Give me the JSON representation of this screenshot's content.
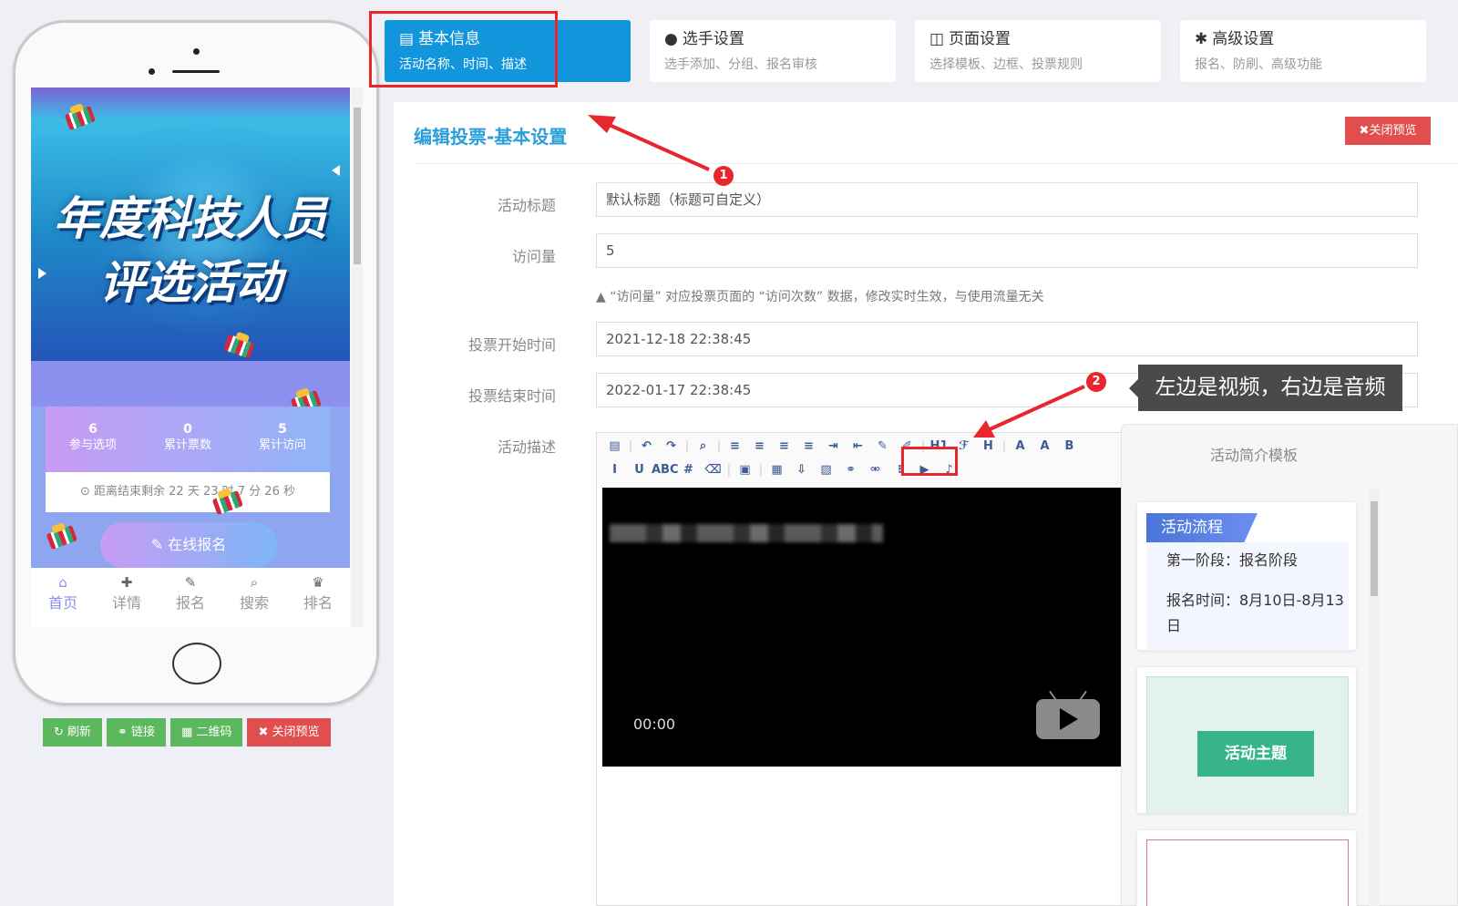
{
  "phone": {
    "banner_line1": "年度科技人员",
    "banner_line2": "评选活动",
    "stats": [
      {
        "num": "6",
        "label": "参与选项"
      },
      {
        "num": "0",
        "label": "累计票数"
      },
      {
        "num": "5",
        "label": "累计访问"
      }
    ],
    "countdown": "⊙ 距离结束剩余 22 天 23 时 7 分 26 秒",
    "signup_button": "✎ 在线报名",
    "nav": [
      {
        "icon": "⌂",
        "label": "首页"
      },
      {
        "icon": "✚",
        "label": "详情"
      },
      {
        "icon": "✎",
        "label": "报名"
      },
      {
        "icon": "⌕",
        "label": "搜索"
      },
      {
        "icon": "♛",
        "label": "排名"
      }
    ]
  },
  "preview_buttons": {
    "refresh": "↻ 刷新",
    "link": "⚭ 链接",
    "qrcode": "▦ 二维码",
    "close": "✖ 关闭预览"
  },
  "tabs": [
    {
      "icon": "▤",
      "title": "基本信息",
      "sub": "活动名称、时间、描述"
    },
    {
      "icon": "●",
      "title": "选手设置",
      "sub": "选手添加、分组、报名审核"
    },
    {
      "icon": "◫",
      "title": "页面设置",
      "sub": "选择模板、边框、投票规则"
    },
    {
      "icon": "✱",
      "title": "高级设置",
      "sub": "报名、防刷、高级功能"
    }
  ],
  "panel": {
    "title": "编辑投票-基本设置",
    "close_preview": "✖关闭预览",
    "fields": {
      "title_label": "活动标题",
      "title_value": "默认标题（标题可自定义）",
      "visits_label": "访问量",
      "visits_value": "5",
      "visits_hint": "▲ “访问量” 对应投票页面的 “访问次数” 数据，修改实时生效，与使用流量无关",
      "start_label": "投票开始时间",
      "start_value": "2021-12-18 22:38:45",
      "end_label": "投票结束时间",
      "end_value": "2022-01-17 22:38:45",
      "desc_label": "活动描述"
    },
    "video_time": "00:00"
  },
  "toolbar_row1": [
    "▤",
    "|",
    "↶",
    "↷",
    "|",
    "⌕",
    "|",
    "≡",
    "≡",
    "≡",
    "≡",
    "⇥",
    "⇤",
    "✎",
    "✐",
    "|",
    "H1",
    "ℱ",
    "H",
    "|",
    "A",
    "A",
    "B"
  ],
  "toolbar_row2": [
    "I",
    "U",
    "ABC",
    "#",
    "⌫",
    "|",
    "▣",
    "|",
    "▦",
    "⇩",
    "▨",
    "⚭",
    "⚮",
    "⁝",
    "▶",
    "♪"
  ],
  "templates": {
    "title": "活动简介模板",
    "tpl1_head": "活动流程",
    "tpl1_line1": "第一阶段：报名阶段",
    "tpl1_line2": "报名时间：8月10日-8月13日",
    "tpl2_badge": "活动主题"
  },
  "annotations": {
    "badge1": "1",
    "badge2": "2",
    "tooltip": "左边是视频，右边是音频"
  }
}
